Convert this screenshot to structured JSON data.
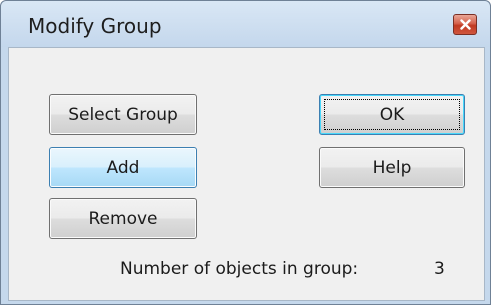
{
  "dialog": {
    "title": "Modify Group",
    "close_icon": "close-icon"
  },
  "buttons": {
    "select_group": "Select Group",
    "add": "Add",
    "remove": "Remove",
    "ok": "OK",
    "help": "Help"
  },
  "info": {
    "count_label": "Number of objects in group:",
    "count_value": "3"
  },
  "colors": {
    "titlebar": "#c5d8ec",
    "close_button": "#c03a22",
    "hover_button": "#bee6fd"
  }
}
